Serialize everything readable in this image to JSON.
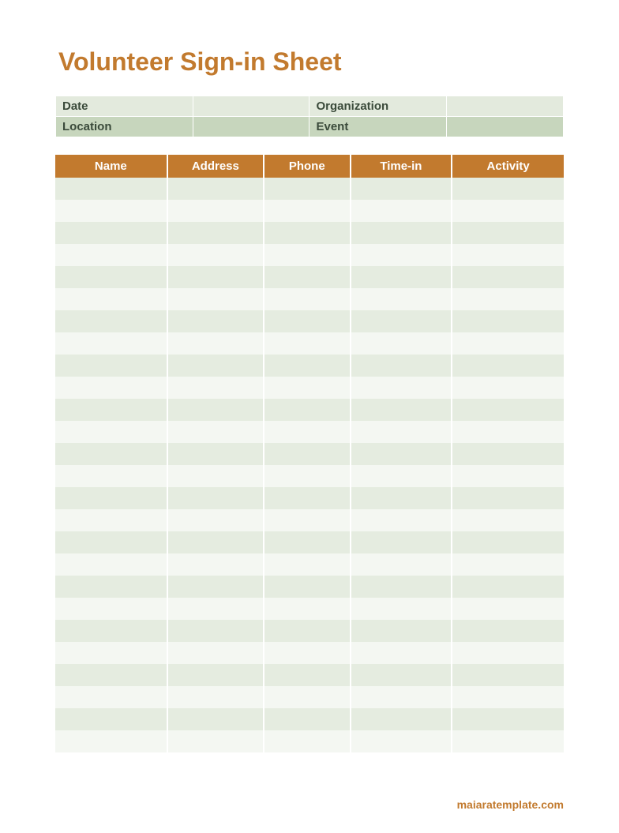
{
  "title": "Volunteer Sign-in Sheet",
  "info": {
    "date_label": "Date",
    "date_value": "",
    "org_label": "Organization",
    "org_value": "",
    "location_label": "Location",
    "location_value": "",
    "event_label": "Event",
    "event_value": ""
  },
  "columns": {
    "name": "Name",
    "address": "Address",
    "phone": "Phone",
    "timein": "Time-in",
    "activity": "Activity"
  },
  "rows": [
    {
      "name": "",
      "address": "",
      "phone": "",
      "timein": "",
      "activity": ""
    },
    {
      "name": "",
      "address": "",
      "phone": "",
      "timein": "",
      "activity": ""
    },
    {
      "name": "",
      "address": "",
      "phone": "",
      "timein": "",
      "activity": ""
    },
    {
      "name": "",
      "address": "",
      "phone": "",
      "timein": "",
      "activity": ""
    },
    {
      "name": "",
      "address": "",
      "phone": "",
      "timein": "",
      "activity": ""
    },
    {
      "name": "",
      "address": "",
      "phone": "",
      "timein": "",
      "activity": ""
    },
    {
      "name": "",
      "address": "",
      "phone": "",
      "timein": "",
      "activity": ""
    },
    {
      "name": "",
      "address": "",
      "phone": "",
      "timein": "",
      "activity": ""
    },
    {
      "name": "",
      "address": "",
      "phone": "",
      "timein": "",
      "activity": ""
    },
    {
      "name": "",
      "address": "",
      "phone": "",
      "timein": "",
      "activity": ""
    },
    {
      "name": "",
      "address": "",
      "phone": "",
      "timein": "",
      "activity": ""
    },
    {
      "name": "",
      "address": "",
      "phone": "",
      "timein": "",
      "activity": ""
    },
    {
      "name": "",
      "address": "",
      "phone": "",
      "timein": "",
      "activity": ""
    },
    {
      "name": "",
      "address": "",
      "phone": "",
      "timein": "",
      "activity": ""
    },
    {
      "name": "",
      "address": "",
      "phone": "",
      "timein": "",
      "activity": ""
    },
    {
      "name": "",
      "address": "",
      "phone": "",
      "timein": "",
      "activity": ""
    },
    {
      "name": "",
      "address": "",
      "phone": "",
      "timein": "",
      "activity": ""
    },
    {
      "name": "",
      "address": "",
      "phone": "",
      "timein": "",
      "activity": ""
    },
    {
      "name": "",
      "address": "",
      "phone": "",
      "timein": "",
      "activity": ""
    },
    {
      "name": "",
      "address": "",
      "phone": "",
      "timein": "",
      "activity": ""
    },
    {
      "name": "",
      "address": "",
      "phone": "",
      "timein": "",
      "activity": ""
    },
    {
      "name": "",
      "address": "",
      "phone": "",
      "timein": "",
      "activity": ""
    },
    {
      "name": "",
      "address": "",
      "phone": "",
      "timein": "",
      "activity": ""
    },
    {
      "name": "",
      "address": "",
      "phone": "",
      "timein": "",
      "activity": ""
    },
    {
      "name": "",
      "address": "",
      "phone": "",
      "timein": "",
      "activity": ""
    },
    {
      "name": "",
      "address": "",
      "phone": "",
      "timein": "",
      "activity": ""
    }
  ],
  "footer": "maiaratemplate.com"
}
